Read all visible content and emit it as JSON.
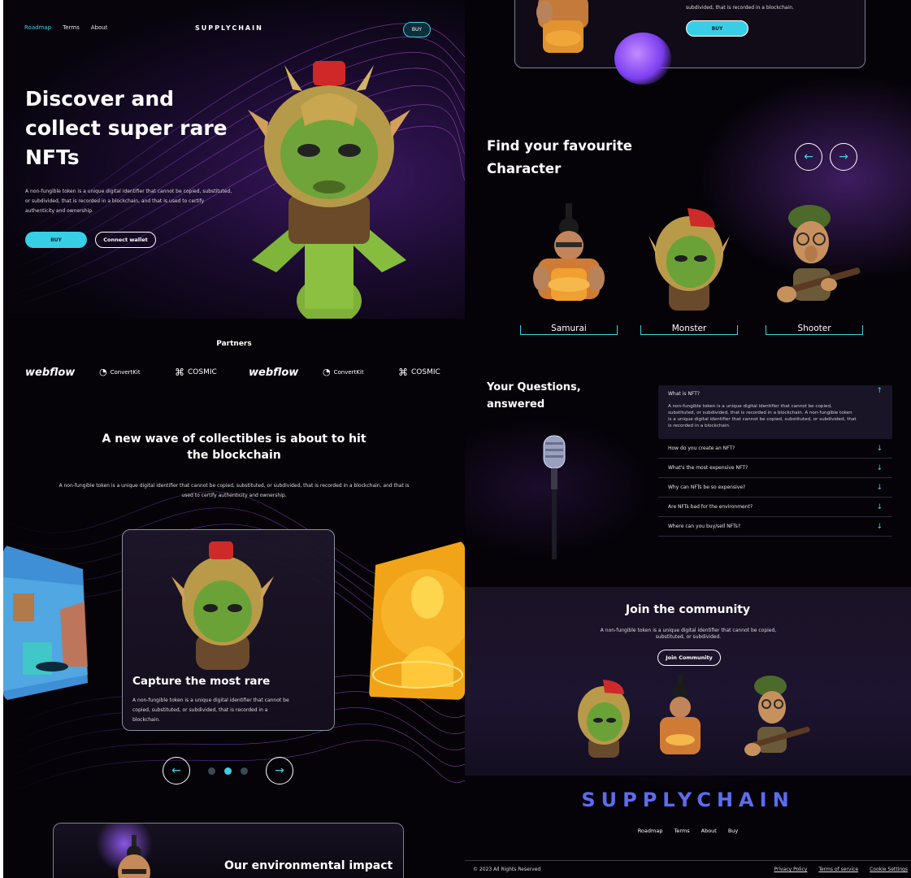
{
  "colors": {
    "accent": "#38cfe6",
    "brand_blue": "#5d6cf0",
    "background": "#050308",
    "purple_glow": "#6e32aa"
  },
  "nav": {
    "items": [
      "Roadmap",
      "Terms",
      "About"
    ],
    "active": "Roadmap",
    "brand": "SUPPLYCHAIN",
    "buy": "BUY"
  },
  "hero": {
    "title": "Discover and collect super rare NFTs",
    "description": "A non-fungible token is a unique digital identifier that cannot be copied, substituted, or subdivided, that is recorded in a blockchain, and that is used to certify authenticity and ownership.",
    "buy": "BUY",
    "connect": "Connect wallet"
  },
  "partners": {
    "title": "Partners",
    "logos": [
      "webflow",
      "ConvertKit",
      "COSMIC",
      "webflow",
      "ConvertKit",
      "COSMIC"
    ]
  },
  "wave": {
    "title": "A new wave of collectibles is about to hit the blockchain",
    "description": "A non-fungible token is a unique digital identifier that cannot be copied, substituted, or subdivided, that is recorded in a blockchain, and that is used to certify authenticity and ownership."
  },
  "carousel_card": {
    "title": "Capture the most rare",
    "description": "A non-fungible token is a unique digital identifier that cannot be copied, substituted, or subdivided, that is recorded in a blockchain.",
    "active_index": 1
  },
  "environment": {
    "title": "Our environmental impact"
  },
  "top_card": {
    "text": "subdivided, that is recorded in a blockchain.",
    "buy": "BUY"
  },
  "characters": {
    "title": "Find your favourite Character",
    "items": [
      "Samurai",
      "Monster",
      "Shooter"
    ]
  },
  "faq": {
    "title": "Your Questions, answered",
    "open": {
      "question": "What is NFT?",
      "answer": "A non-fungible token is a unique digital identifier that cannot be copied, substituted, or subdivided, that is recorded in a blockchain. A non-fungible token is a unique digital identifier that cannot be copied, substituted, or subdivided, that is recorded in a blockchain."
    },
    "questions": [
      "How do you create an NFT?",
      "What's the most expensive NFT?",
      "Why can NFTs be so expensive?",
      "Are NFTs bad for the environment?",
      "Where can you buy/sell NFTs?"
    ]
  },
  "community": {
    "title": "Join the community",
    "description": "A non-fungible token is a unique digital identifier that cannot be copied, substituted, or subdivided.",
    "button": "Join Community"
  },
  "footer": {
    "brand": "SUPPLYCHAIN",
    "links": [
      "Roadmap",
      "Terms",
      "About",
      "Buy"
    ],
    "copyright": "© 2023 All Rights Reserved",
    "legal": [
      "Privacy Policy",
      "Terms of service",
      "Cookie Settings"
    ]
  }
}
